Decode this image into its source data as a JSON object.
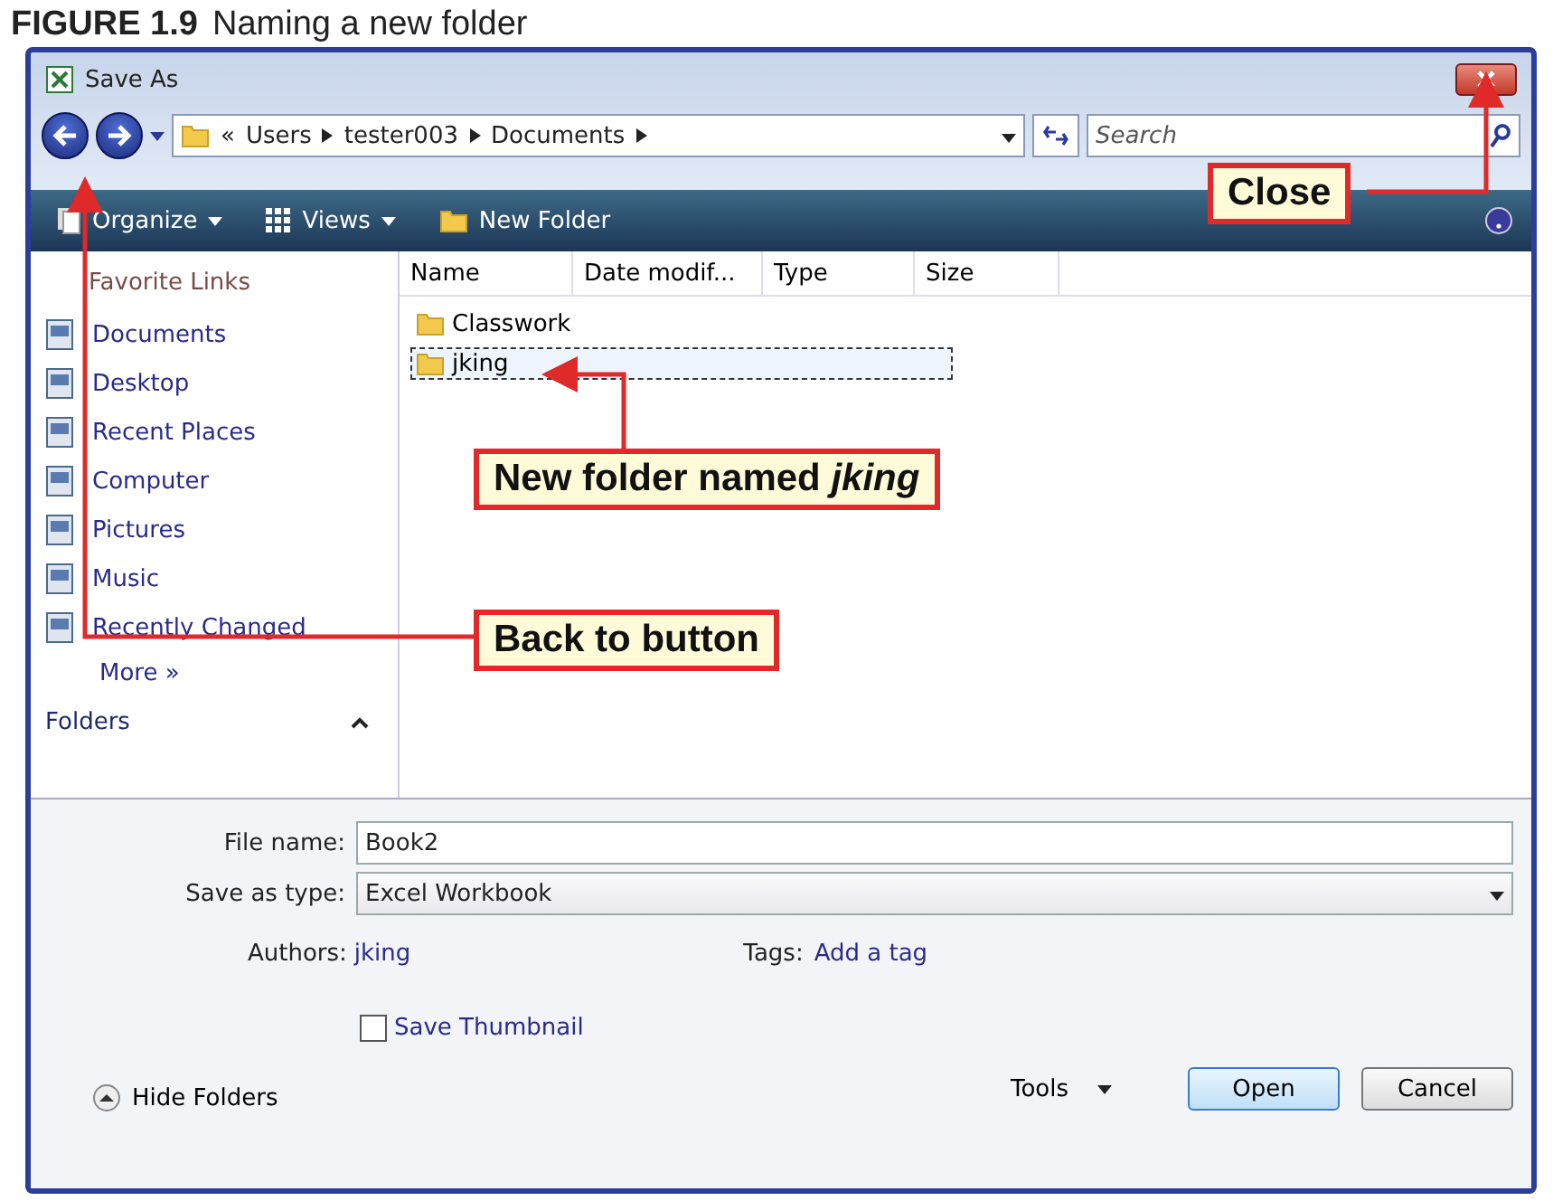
{
  "caption": {
    "number": "FIGURE 1.9",
    "title": "Naming a new folder"
  },
  "window": {
    "title": "Save As"
  },
  "address": {
    "crumbs": [
      "Users",
      "tester003",
      "Documents"
    ],
    "overflow": "«"
  },
  "search": {
    "placeholder": "Search"
  },
  "toolbar": [
    {
      "label": "Organize",
      "dropdown": true,
      "kind": "organize"
    },
    {
      "label": "Views",
      "dropdown": true,
      "kind": "views"
    },
    {
      "label": "New Folder",
      "dropdown": false,
      "kind": "newfolder"
    }
  ],
  "sidebar": {
    "title": "Favorite Links",
    "items": [
      "Documents",
      "Desktop",
      "Recent Places",
      "Computer",
      "Pictures",
      "Music",
      "Recently Changed"
    ],
    "more": "More",
    "more_glyph": "»",
    "folders": "Folders"
  },
  "files": {
    "columns": [
      "Name",
      "Date modif...",
      "Type",
      "Size"
    ],
    "rows": [
      {
        "name": "Classwork",
        "selected": false
      },
      {
        "name": "jking",
        "selected": true
      }
    ]
  },
  "form": {
    "file_name_label": "File name:",
    "file_name": "Book2",
    "type_label": "Save as type:",
    "type": "Excel Workbook",
    "authors_label": "Authors:",
    "authors": "jking",
    "tags_label": "Tags:",
    "tags": "Add a tag",
    "thumbnail": {
      "label": "Save Thumbnail",
      "checked": false
    }
  },
  "hide_folders": "Hide Folders",
  "buttons": {
    "tools": "Tools",
    "open": "Open",
    "cancel": "Cancel"
  },
  "callouts": [
    {
      "text": "Close"
    },
    {
      "text": "New folder named *jking*"
    },
    {
      "text": "Back to button"
    }
  ]
}
